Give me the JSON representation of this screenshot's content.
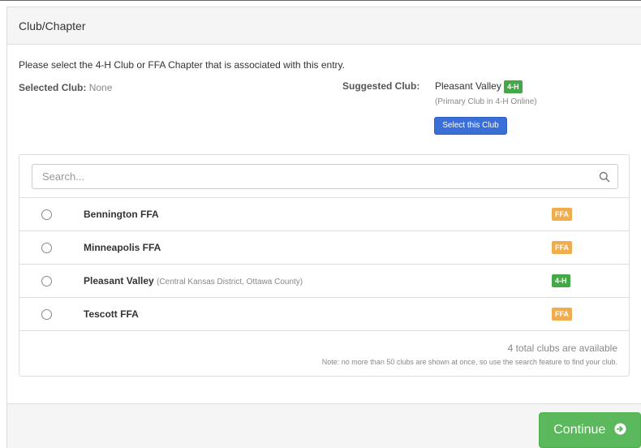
{
  "panel": {
    "title": "Club/Chapter",
    "intro": "Please select the 4-H Club or FFA Chapter that is associated with this entry.",
    "selected_label": "Selected Club:",
    "selected_value": "None",
    "suggested_label": "Suggested Club:",
    "suggested_name": "Pleasant Valley",
    "suggested_badge": "4-H",
    "suggested_sub": "(Primary Club in 4-H Online)",
    "select_button": "Select this Club"
  },
  "search": {
    "placeholder": "Search...",
    "icon": "search-icon"
  },
  "clubs": [
    {
      "name": "Bennington FFA",
      "detail": "",
      "badge": "FFA",
      "badge_color": "#f0ad4e"
    },
    {
      "name": "Minneapolis FFA",
      "detail": "",
      "badge": "FFA",
      "badge_color": "#f0ad4e"
    },
    {
      "name": "Pleasant Valley",
      "detail": "(Central Kansas District, Ottawa County)",
      "badge": "4-H",
      "badge_color": "#45a847"
    },
    {
      "name": "Tescott FFA",
      "detail": "",
      "badge": "FFA",
      "badge_color": "#f0ad4e"
    }
  ],
  "summary": {
    "total": "4 total clubs are available",
    "note": "Note: no more than 50 clubs are shown at once, so use the search feature to find your club."
  },
  "footer": {
    "continue_label": "Continue",
    "continue_icon": "arrow-circle-right-icon"
  },
  "colors": {
    "primary": "#3a6fd8",
    "success": "#5cb85c",
    "badge_4h": "#45a847",
    "badge_ffa": "#f0ad4e"
  }
}
